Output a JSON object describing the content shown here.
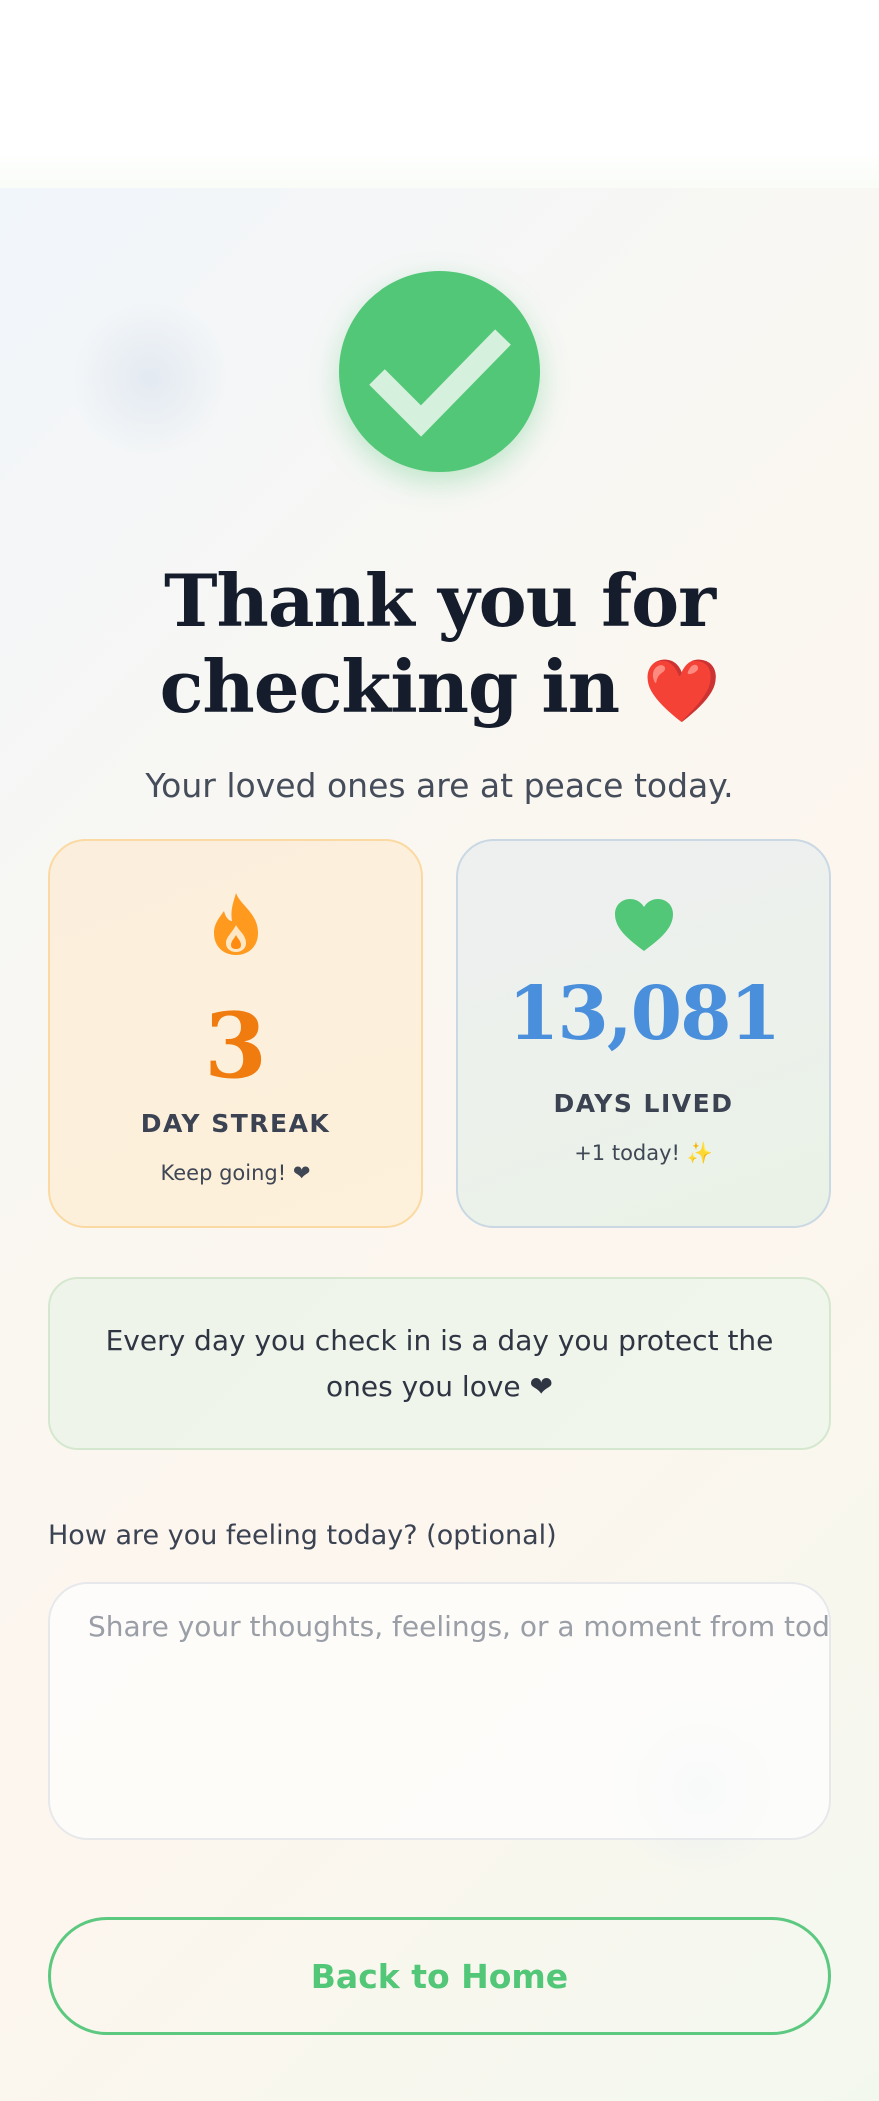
{
  "header": {
    "title": "Thank you for checking in",
    "title_emoji": "❤️",
    "subtitle": "Your loved ones are at peace today."
  },
  "status_icon": "checkmark-circle-icon",
  "colors": {
    "success_green": "#52c777",
    "streak_orange": "#f07c10",
    "days_blue": "#4a8fdc"
  },
  "streak_card": {
    "icon": "flame-icon",
    "value": "3",
    "label": "DAY STREAK",
    "note": "Keep going! ❤"
  },
  "days_card": {
    "icon": "heart-icon",
    "value": "13,081",
    "label": "DAYS LIVED",
    "note": "+1 today! ✨"
  },
  "quote": {
    "text": "Every day you check in is a day you protect the ones you love ❤"
  },
  "feeling": {
    "label": "How are you feeling today? (optional)",
    "placeholder": "Share your thoughts, feelings, or a moment from today...",
    "value": ""
  },
  "actions": {
    "back_home_label": "Back to Home"
  }
}
